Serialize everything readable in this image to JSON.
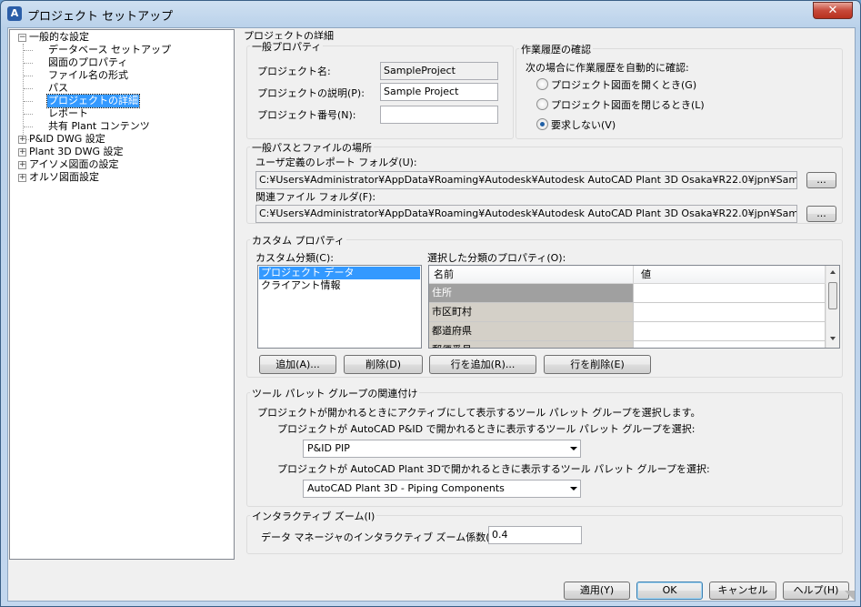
{
  "window": {
    "title": "プロジェクト セットアップ",
    "app_icon": "A",
    "close": "✕"
  },
  "tree": {
    "root1": "一般的な設定",
    "children": [
      "データベース セットアップ",
      "図面のプロパティ",
      "ファイル名の形式",
      "パス",
      "プロジェクトの詳細",
      "レポート",
      "共有 Plant コンテンツ"
    ],
    "selected_index": 4,
    "others": [
      "P&ID DWG 設定",
      "Plant 3D DWG 設定",
      "アイソメ図面の設定",
      "オルソ図面設定"
    ],
    "expand_minus": "−",
    "expand_plus": "+"
  },
  "details": {
    "group_title": "プロジェクトの詳細",
    "general": {
      "title": "一般プロパティ",
      "name_label": "プロジェクト名:",
      "name_value": "SampleProject",
      "desc_label": "プロジェクトの説明(P):",
      "desc_value": "Sample Project",
      "number_label": "プロジェクト番号(N):",
      "number_value": ""
    },
    "history": {
      "title": "作業履歴の確認",
      "caption": "次の場合に作業履歴を自動的に確認:",
      "options": [
        "プロジェクト図面を開くとき(G)",
        "プロジェクト図面を閉じるとき(L)",
        "要求しない(V)"
      ],
      "selected": 2
    },
    "paths": {
      "title": "一般パスとファイルの場所",
      "report_label": "ユーザ定義のレポート フォルダ(U):",
      "report_value": "C:¥Users¥Administrator¥AppData¥Roaming¥Autodesk¥Autodesk AutoCAD Plant 3D Osaka¥R22.0¥jpn¥SampleProjects¥Sample",
      "related_label": "関連ファイル フォルダ(F):",
      "related_value": "C:¥Users¥Administrator¥AppData¥Roaming¥Autodesk¥Autodesk AutoCAD Plant 3D Osaka¥R22.0¥jpn¥SampleProjects¥Sample",
      "browse": "..."
    },
    "custom": {
      "title": "カスタム プロパティ",
      "cat_label": "カスタム分類(C):",
      "categories": [
        "プロジェクト データ",
        "クライアント情報"
      ],
      "selected_cat": 0,
      "props_label": "選択した分類のプロパティ(O):",
      "col_name": "名前",
      "col_value": "値",
      "rows": [
        "住所",
        "市区町村",
        "都道府県",
        "郵便番号"
      ],
      "add": "追加(A)...",
      "delete": "削除(D)",
      "add_row": "行を追加(R)...",
      "delete_row": "行を削除(E)"
    },
    "palette": {
      "title": "ツール パレット グループの関連付け",
      "desc": "プロジェクトが開かれるときにアクティブにして表示するツール パレット グループを選択します。",
      "pid_label": "プロジェクトが AutoCAD P&ID で開かれるときに表示するツール パレット グループを選択:",
      "pid_value": "P&ID PIP",
      "p3d_label": "プロジェクトが AutoCAD Plant 3Dで開かれるときに表示するツール パレット グループを選択:",
      "p3d_value": "AutoCAD Plant 3D - Piping Components"
    },
    "zoom": {
      "title": "インタラクティブ ズーム(I)",
      "label": "データ マネージャのインタラクティブ ズーム係数(Z):",
      "value": "0.4"
    }
  },
  "buttons": {
    "apply": "適用(Y)",
    "ok": "OK",
    "cancel": "キャンセル",
    "help": "ヘルプ(H)"
  }
}
